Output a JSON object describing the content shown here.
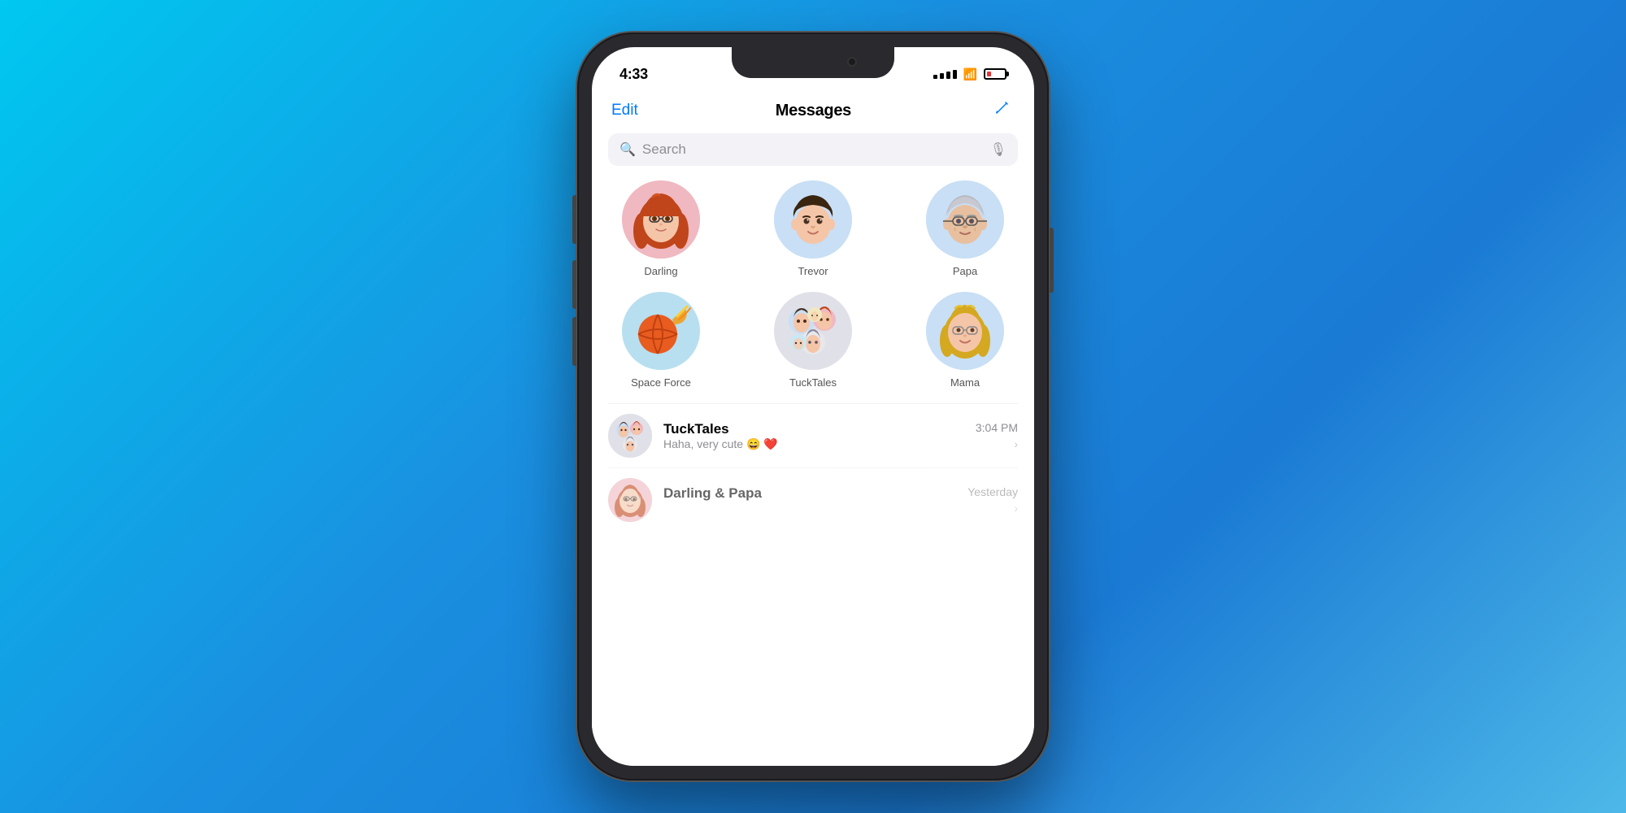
{
  "background": {
    "gradient_start": "#00c8f0",
    "gradient_end": "#1a7ad4"
  },
  "status_bar": {
    "time": "4:33",
    "signal_label": "signal",
    "wifi_label": "wifi",
    "battery_label": "battery",
    "battery_color": "#e53535"
  },
  "header": {
    "edit_label": "Edit",
    "title": "Messages",
    "compose_label": "compose"
  },
  "search": {
    "placeholder": "Search"
  },
  "pinned_row1": [
    {
      "name": "Darling",
      "emoji": "👩‍🦰",
      "bg_class": "avatar-darling"
    },
    {
      "name": "Trevor",
      "emoji": "👦",
      "bg_class": "avatar-trevor"
    },
    {
      "name": "Papa",
      "emoji": "👴",
      "bg_class": "avatar-papa"
    }
  ],
  "pinned_row2": [
    {
      "name": "Space Force",
      "emoji": "🏀",
      "bg_class": "avatar-spaceforce"
    },
    {
      "name": "TuckTales",
      "emoji": "👨‍👩‍👧",
      "bg_class": "avatar-tucktales"
    },
    {
      "name": "Mama",
      "emoji": "👩‍🦳",
      "bg_class": "avatar-mama"
    }
  ],
  "messages": [
    {
      "name": "TuckTales",
      "preview": "Haha, very cute 😄 ❤️",
      "time": "3:04 PM",
      "emoji": "👨‍👩‍👧",
      "bg_class": "avatar-tucktales"
    },
    {
      "name": "Darling & Papa",
      "preview": "",
      "time": "Yesterday",
      "emoji": "👩‍🦰",
      "bg_class": "avatar-darling"
    }
  ]
}
